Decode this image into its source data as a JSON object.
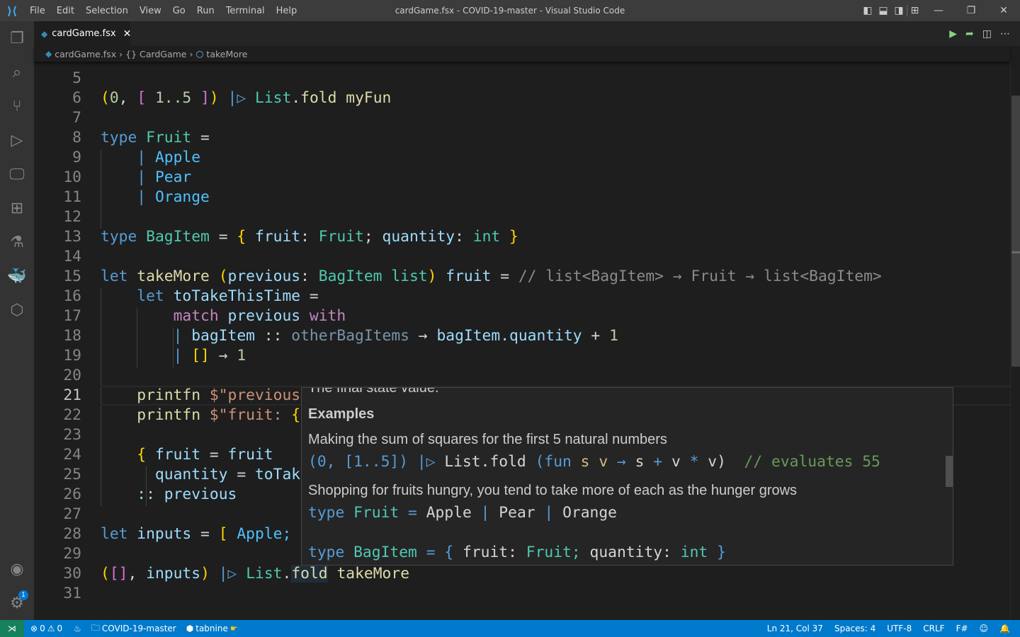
{
  "window": {
    "title": "cardGame.fsx - COVID-19-master - Visual Studio Code",
    "menu": [
      "File",
      "Edit",
      "Selection",
      "View",
      "Go",
      "Run",
      "Terminal",
      "Help"
    ]
  },
  "tab": {
    "label": "cardGame.fsx",
    "close": "✕"
  },
  "breadcrumb": [
    "cardGame.fsx",
    "CardGame",
    "takeMore"
  ],
  "colors": {
    "accent": "#007acc",
    "remote": "#16825d",
    "run": "#89d185"
  },
  "editor": {
    "lines": [
      {
        "n": "5",
        "t": []
      },
      {
        "n": "6",
        "t": [
          [
            "(",
            "br1"
          ],
          [
            "0",
            "num"
          ],
          [
            ", ",
            "op"
          ],
          [
            "[",
            "br2"
          ],
          [
            " 1..5 ",
            "num"
          ],
          [
            "]",
            "br2"
          ],
          [
            ")",
            "br1"
          ],
          [
            " |▷ ",
            "kw"
          ],
          [
            "List",
            "ty"
          ],
          [
            ".fold myFun",
            "fn"
          ]
        ]
      },
      {
        "n": "7",
        "t": []
      },
      {
        "n": "8",
        "t": [
          [
            "type",
            "kw"
          ],
          [
            " Fruit",
            "ty"
          ],
          [
            " =",
            "op"
          ]
        ]
      },
      {
        "n": "9",
        "t": [
          [
            "    | ",
            "kw"
          ],
          [
            "Apple",
            "uc"
          ]
        ]
      },
      {
        "n": "10",
        "t": [
          [
            "    | ",
            "kw"
          ],
          [
            "Pear",
            "uc"
          ]
        ]
      },
      {
        "n": "11",
        "t": [
          [
            "    | ",
            "kw"
          ],
          [
            "Orange",
            "uc"
          ]
        ]
      },
      {
        "n": "12",
        "t": []
      },
      {
        "n": "13",
        "t": [
          [
            "type",
            "kw"
          ],
          [
            " BagItem",
            "ty"
          ],
          [
            " = ",
            "op"
          ],
          [
            "{",
            "br1"
          ],
          [
            " fruit",
            "var"
          ],
          [
            ": ",
            "op"
          ],
          [
            "Fruit",
            "ty"
          ],
          [
            "; ",
            "op"
          ],
          [
            "quantity",
            "var"
          ],
          [
            ": ",
            "op"
          ],
          [
            "int",
            "ty"
          ],
          [
            " }",
            "br1"
          ]
        ]
      },
      {
        "n": "14",
        "t": []
      },
      {
        "n": "15",
        "t": [
          [
            "let",
            "kw"
          ],
          [
            " takeMore ",
            "fn"
          ],
          [
            "(",
            "br1"
          ],
          [
            "previous",
            "var"
          ],
          [
            ": ",
            "op"
          ],
          [
            "BagItem list",
            "ty"
          ],
          [
            ")",
            "br1"
          ],
          [
            " fruit",
            "var"
          ],
          [
            " = ",
            "op"
          ],
          [
            "// list<BagItem> → Fruit → list<BagItem>",
            "cm"
          ]
        ]
      },
      {
        "n": "16",
        "t": [
          [
            "    let",
            "kw"
          ],
          [
            " toTakeThisTime",
            "var"
          ],
          [
            " =",
            "op"
          ]
        ]
      },
      {
        "n": "17",
        "t": [
          [
            "        match",
            "ctl"
          ],
          [
            " previous ",
            "var"
          ],
          [
            "with",
            "ctl"
          ]
        ]
      },
      {
        "n": "18",
        "t": [
          [
            "        | ",
            "kw"
          ],
          [
            "bagItem",
            "var"
          ],
          [
            " :: ",
            "op"
          ],
          [
            "otherBagItems",
            "dim"
          ],
          [
            " → ",
            "op"
          ],
          [
            "bagItem.quantity",
            "var"
          ],
          [
            " + ",
            "op"
          ],
          [
            "1",
            "num"
          ]
        ]
      },
      {
        "n": "19",
        "t": [
          [
            "        | ",
            "kw"
          ],
          [
            "[]",
            "br1"
          ],
          [
            " → ",
            "op"
          ],
          [
            "1",
            "num"
          ]
        ]
      },
      {
        "n": "20",
        "t": []
      },
      {
        "n": "21",
        "t": [
          [
            "    printfn ",
            "fn"
          ],
          [
            "$\"previous",
            "str"
          ]
        ],
        "current": true
      },
      {
        "n": "22",
        "t": [
          [
            "    printfn ",
            "fn"
          ],
          [
            "$\"fruit: ",
            "str"
          ],
          [
            "{",
            "br1"
          ]
        ]
      },
      {
        "n": "23",
        "t": []
      },
      {
        "n": "24",
        "t": [
          [
            "    { ",
            "br1"
          ],
          [
            "fruit",
            "var"
          ],
          [
            " = ",
            "op"
          ],
          [
            "fruit",
            "var"
          ]
        ]
      },
      {
        "n": "25",
        "t": [
          [
            "      quantity",
            "var"
          ],
          [
            " = ",
            "op"
          ],
          [
            "toTak",
            "var"
          ]
        ]
      },
      {
        "n": "26",
        "t": [
          [
            "    :: ",
            "var"
          ],
          [
            "previous",
            "var"
          ]
        ]
      },
      {
        "n": "27",
        "t": []
      },
      {
        "n": "28",
        "t": [
          [
            "let",
            "kw"
          ],
          [
            " inputs",
            "var"
          ],
          [
            " = ",
            "op"
          ],
          [
            "[",
            "br1"
          ],
          [
            " Apple;",
            "uc"
          ]
        ]
      },
      {
        "n": "29",
        "t": []
      },
      {
        "n": "30",
        "t": [
          [
            "(",
            "br1"
          ],
          [
            "[]",
            "br2"
          ],
          [
            ", ",
            "op"
          ],
          [
            "inputs",
            "var"
          ],
          [
            ")",
            "br1"
          ],
          [
            " |▷ ",
            "kw"
          ],
          [
            "List",
            "ty"
          ],
          [
            ".",
            "op"
          ],
          [
            "fold",
            "fn hl"
          ],
          [
            " takeMore",
            "fn"
          ]
        ]
      },
      {
        "n": "31",
        "t": []
      }
    ]
  },
  "hover": {
    "clipped_text": "The final state value.",
    "examples_heading": "Examples",
    "p1": "Making the sum of squares for the first 5 natural numbers",
    "code1": [
      [
        "(0, [1..5]) ",
        "br3"
      ],
      [
        "|▷ ",
        "kw"
      ],
      [
        "List.fold ",
        "pl"
      ],
      [
        "(fun ",
        "kw"
      ],
      [
        "s v ",
        "br1"
      ],
      [
        "→ ",
        "kw"
      ],
      [
        "s ",
        "pl"
      ],
      [
        "+ ",
        "kw"
      ],
      [
        "v ",
        "pl"
      ],
      [
        "* ",
        "kw"
      ],
      [
        "v)",
        "pl"
      ],
      [
        "  // evaluates 55",
        "cmg"
      ]
    ],
    "p2": "Shopping for fruits hungry, you tend to take more of each as the hunger grows",
    "code2": [
      [
        "type ",
        "kw"
      ],
      [
        "Fruit ",
        "ty"
      ],
      [
        "= ",
        "kw"
      ],
      [
        "Apple ",
        "pl"
      ],
      [
        "| ",
        "kw"
      ],
      [
        "Pear ",
        "pl"
      ],
      [
        "| ",
        "kw"
      ],
      [
        "Orange",
        "pl"
      ]
    ],
    "code3": [
      [
        "type ",
        "kw"
      ],
      [
        "BagItem ",
        "ty"
      ],
      [
        "= ",
        "kw"
      ],
      [
        "{ ",
        "kw"
      ],
      [
        "fruit: ",
        "pl"
      ],
      [
        "Fruit; ",
        "ty"
      ],
      [
        "quantity: ",
        "pl"
      ],
      [
        "int ",
        "ty"
      ],
      [
        "}",
        "kw"
      ]
    ]
  },
  "status": {
    "errors": "0",
    "warnings": "0",
    "folder": "COVID-19-master",
    "tabnine": "tabnine",
    "position": "Ln 21, Col 37",
    "spaces": "Spaces: 4",
    "encoding": "UTF-8",
    "eol": "CRLF",
    "language": "F#",
    "notifications_badge": "1"
  }
}
